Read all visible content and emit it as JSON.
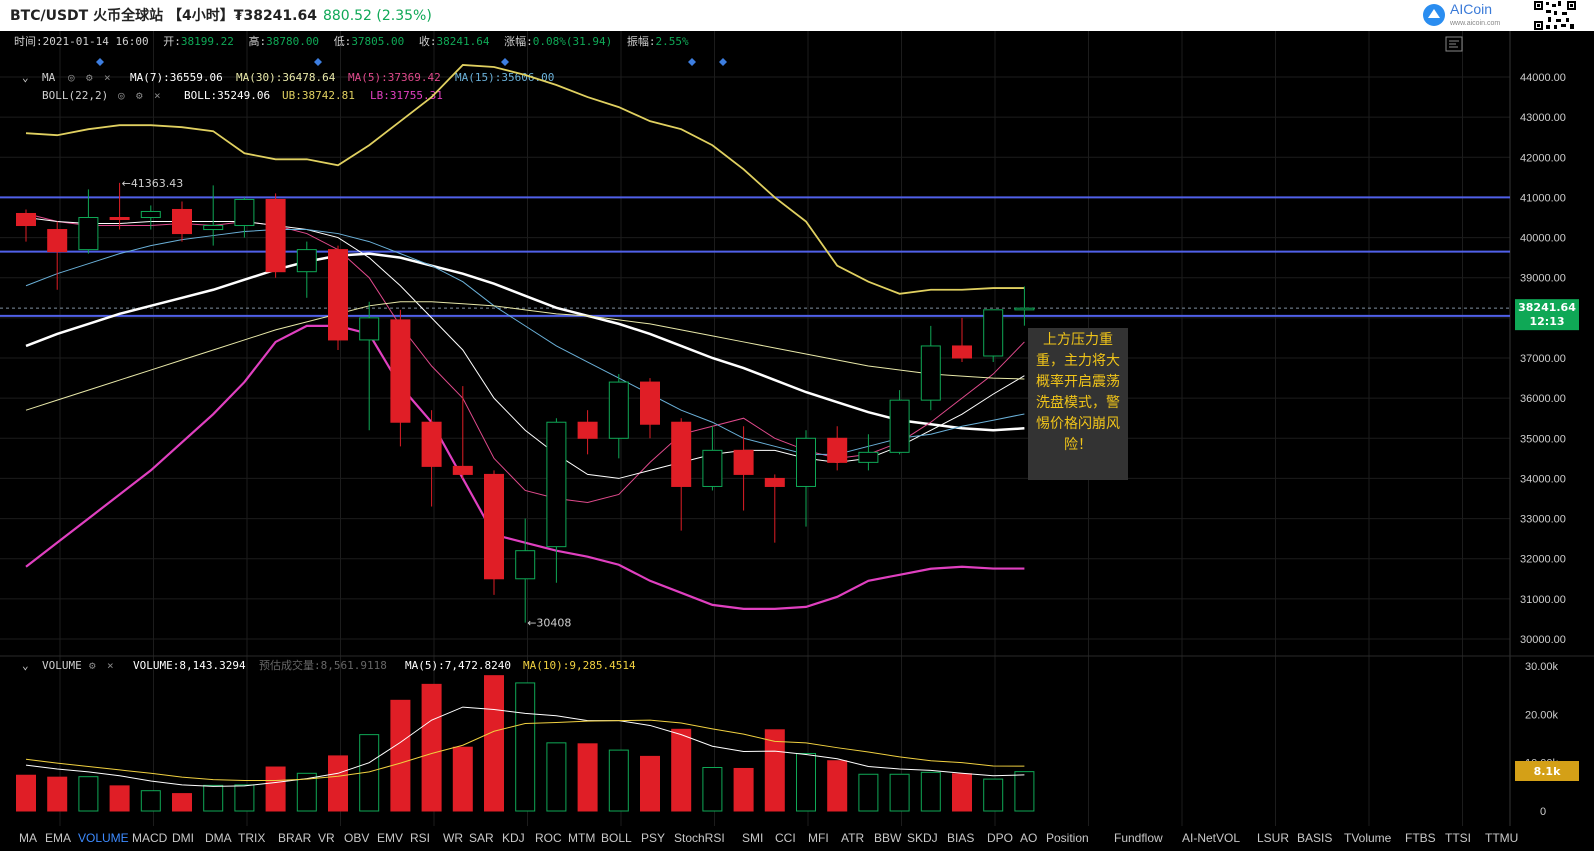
{
  "header": {
    "title": "BTC/USDT 火币全球站 【4小时】₮38241.64",
    "change": "880.52 (2.35%)",
    "logo_text": "AICoin",
    "logo_sub": "www.aicoin.com"
  },
  "info_bar": {
    "time_label": "时间:",
    "time": "2021-01-14 16:00",
    "open_label": "开:",
    "open": "38199.22",
    "high_label": "高:",
    "high": "38780.00",
    "low_label": "低:",
    "low": "37805.00",
    "close_label": "收:",
    "close": "38241.64",
    "chg_label": "涨幅:",
    "chg": "0.08%(31.94)",
    "amp_label": "振幅:",
    "amp": "2.55%"
  },
  "ma_legend": {
    "name": "MA",
    "ma7": "MA(7):36559.06",
    "ma30": "MA(30):36478.64",
    "ma5": "MA(5):37369.42",
    "ma15": "MA(15):35606.00"
  },
  "boll_legend": {
    "name": "BOLL(22,2)",
    "boll": "BOLL:35249.06",
    "ub": "UB:38742.81",
    "lb": "LB:31755.31"
  },
  "volume_legend": {
    "name": "VOLUME",
    "vol": "VOLUME:8,143.3294",
    "est": "预估成交量:8,561.9118",
    "ma5": "MA(5):7,472.8240",
    "ma10": "MA(10):9,285.4514"
  },
  "annotations": {
    "high_mark": "41363.43",
    "low_mark": "30408",
    "callout": "上方压力重重，主力将大概率开启震荡洗盘模式，警惕价格闪崩风险！"
  },
  "price_tag": {
    "price": "38241.64",
    "countdown": "12:13"
  },
  "volume_tag": "8.1k",
  "colors": {
    "up": "#0fa856",
    "down": "#e01e26",
    "ma7": "#ffffff",
    "ma30": "#e8e8a8",
    "ma5": "#e04a8c",
    "ma15": "#6ab0d8",
    "boll_mid": "#ffffff",
    "boll_ub": "#e0d060",
    "boll_lb": "#e040c0",
    "hline": "#5060e8"
  },
  "tabs": [
    "MA",
    "EMA",
    "VOLUME",
    "MACD",
    "DMI",
    "DMA",
    "TRIX",
    "BRAR",
    "VR",
    "OBV",
    "EMV",
    "RSI",
    "WR",
    "SAR",
    "KDJ",
    "ROC",
    "MTM",
    "BOLL",
    "PSY",
    "StochRSI",
    "SMI",
    "CCI",
    "MFI",
    "ATR",
    "BBW",
    "SKDJ",
    "BIAS",
    "DPO",
    "AO",
    "Position",
    "Fundflow",
    "AI-NetVOL",
    "LSUR",
    "BASIS",
    "TVolume",
    "FTBS",
    "TTSI",
    "TTMU"
  ],
  "active_tab": "VOLUME",
  "chart_data": {
    "type": "candlestick",
    "price_axis": {
      "min": 30000,
      "max": 44000,
      "ticks": [
        "44000.00",
        "43000.00",
        "42000.00",
        "41000.00",
        "40000.00",
        "39000.00",
        "38000.00",
        "37000.00",
        "36000.00",
        "35000.00",
        "34000.00",
        "33000.00",
        "32000.00",
        "31000.00",
        "30000.00"
      ]
    },
    "volume_axis": {
      "ticks": [
        "30.00k",
        "20.00k",
        "10.00k",
        "0"
      ]
    },
    "horizontal_lines": [
      41000,
      39650,
      38050
    ],
    "candles": [
      {
        "o": 40600,
        "h": 40700,
        "l": 39900,
        "c": 40300
      },
      {
        "o": 40200,
        "h": 40400,
        "l": 38700,
        "c": 39650
      },
      {
        "o": 39700,
        "h": 41200,
        "l": 39600,
        "c": 40500
      },
      {
        "o": 40500,
        "h": 41363,
        "l": 40200,
        "c": 40450
      },
      {
        "o": 40500,
        "h": 40800,
        "l": 40200,
        "c": 40650
      },
      {
        "o": 40700,
        "h": 40900,
        "l": 39900,
        "c": 40100
      },
      {
        "o": 40200,
        "h": 41300,
        "l": 39800,
        "c": 40300
      },
      {
        "o": 40300,
        "h": 41000,
        "l": 40000,
        "c": 40950
      },
      {
        "o": 40950,
        "h": 41100,
        "l": 39000,
        "c": 39150
      },
      {
        "o": 39150,
        "h": 39900,
        "l": 38500,
        "c": 39700
      },
      {
        "o": 39700,
        "h": 39800,
        "l": 37200,
        "c": 37450
      },
      {
        "o": 37450,
        "h": 38400,
        "l": 35200,
        "c": 38000
      },
      {
        "o": 37950,
        "h": 38200,
        "l": 34800,
        "c": 35400
      },
      {
        "o": 35400,
        "h": 35700,
        "l": 33300,
        "c": 34300
      },
      {
        "o": 34300,
        "h": 36300,
        "l": 34000,
        "c": 34100
      },
      {
        "o": 34100,
        "h": 34200,
        "l": 31100,
        "c": 31500
      },
      {
        "o": 31500,
        "h": 33000,
        "l": 30408,
        "c": 32200
      },
      {
        "o": 32300,
        "h": 35500,
        "l": 31400,
        "c": 35400
      },
      {
        "o": 35400,
        "h": 35700,
        "l": 34600,
        "c": 35000
      },
      {
        "o": 35000,
        "h": 36600,
        "l": 34500,
        "c": 36400
      },
      {
        "o": 36400,
        "h": 36500,
        "l": 35000,
        "c": 35350
      },
      {
        "o": 35400,
        "h": 35500,
        "l": 32700,
        "c": 33800
      },
      {
        "o": 33800,
        "h": 35300,
        "l": 33700,
        "c": 34700
      },
      {
        "o": 34700,
        "h": 35300,
        "l": 33200,
        "c": 34100
      },
      {
        "o": 34000,
        "h": 34100,
        "l": 32400,
        "c": 33800
      },
      {
        "o": 33800,
        "h": 35200,
        "l": 32800,
        "c": 35000
      },
      {
        "o": 35000,
        "h": 35300,
        "l": 34200,
        "c": 34400
      },
      {
        "o": 34400,
        "h": 35100,
        "l": 34200,
        "c": 34650
      },
      {
        "o": 34650,
        "h": 36200,
        "l": 34600,
        "c": 35950
      },
      {
        "o": 35950,
        "h": 37800,
        "l": 35700,
        "c": 37300
      },
      {
        "o": 37300,
        "h": 38000,
        "l": 36900,
        "c": 37000
      },
      {
        "o": 37050,
        "h": 38200,
        "l": 36900,
        "c": 38200
      },
      {
        "o": 38199,
        "h": 38780,
        "l": 37805,
        "c": 38241
      }
    ],
    "volumes": [
      7400,
      7000,
      7100,
      5200,
      4200,
      3600,
      5300,
      5400,
      9100,
      7800,
      11400,
      15800,
      22900,
      26200,
      13200,
      28000,
      26500,
      14100,
      13900,
      12600,
      11300,
      16900,
      9000,
      8800,
      16800,
      11900,
      10400,
      7600,
      7600,
      8000,
      7700,
      6600,
      8143
    ],
    "series": [
      {
        "name": "MA(5)",
        "values": [
          40600,
          40400,
          40300,
          40300,
          40300,
          40350,
          40300,
          40400,
          40300,
          40100,
          39700,
          39000,
          37800,
          36800,
          36000,
          34500,
          33700,
          33500,
          33400,
          33600,
          34400,
          35100,
          35300,
          35500,
          35000,
          34700,
          34500,
          34600,
          34900,
          35400,
          36000,
          36600,
          37400
        ]
      },
      {
        "name": "MA(7)",
        "values": [
          40500,
          40400,
          40350,
          40350,
          40400,
          40400,
          40400,
          40400,
          40300,
          40200,
          40000,
          39500,
          38800,
          38000,
          37200,
          36000,
          35200,
          34600,
          34100,
          34000,
          34200,
          34400,
          34600,
          34700,
          34700,
          34500,
          34400,
          34500,
          34800,
          35200,
          35600,
          36100,
          36559
        ]
      },
      {
        "name": "MA(15)",
        "values": [
          38800,
          39100,
          39350,
          39600,
          39800,
          39950,
          40050,
          40150,
          40200,
          40200,
          40100,
          39900,
          39600,
          39300,
          38900,
          38300,
          37800,
          37300,
          36900,
          36500,
          36100,
          35700,
          35400,
          35000,
          34800,
          34600,
          34600,
          34800,
          35000,
          35100,
          35300,
          35450,
          35606
        ]
      },
      {
        "name": "MA(30)",
        "values": [
          35700,
          35950,
          36200,
          36450,
          36700,
          36950,
          37200,
          37450,
          37700,
          37900,
          38100,
          38300,
          38400,
          38400,
          38350,
          38300,
          38200,
          38100,
          38050,
          37950,
          37850,
          37700,
          37550,
          37400,
          37250,
          37100,
          36950,
          36800,
          36700,
          36600,
          36550,
          36500,
          36478
        ]
      },
      {
        "name": "BOLL",
        "values": [
          37300,
          37600,
          37850,
          38100,
          38300,
          38500,
          38700,
          38950,
          39200,
          39400,
          39550,
          39600,
          39500,
          39300,
          39100,
          38850,
          38550,
          38250,
          38050,
          37850,
          37600,
          37300,
          37000,
          36750,
          36450,
          36150,
          35900,
          35650,
          35450,
          35350,
          35250,
          35200,
          35249
        ]
      },
      {
        "name": "UB",
        "values": [
          42600,
          42550,
          42700,
          42800,
          42800,
          42750,
          42650,
          42100,
          41950,
          41950,
          41800,
          42300,
          42900,
          43500,
          44300,
          44250,
          44050,
          43800,
          43500,
          43250,
          42900,
          42700,
          42300,
          41700,
          41000,
          40400,
          39300,
          38900,
          38600,
          38700,
          38700,
          38742,
          38742
        ]
      },
      {
        "name": "LB",
        "values": [
          31800,
          32400,
          33000,
          33600,
          34200,
          34900,
          35600,
          36400,
          37400,
          37800,
          37800,
          37600,
          36300,
          35400,
          34000,
          32600,
          32400,
          32200,
          32050,
          31850,
          31450,
          31150,
          30850,
          30750,
          30750,
          30800,
          31050,
          31450,
          31600,
          31750,
          31800,
          31755,
          31755
        ]
      },
      {
        "name": "VOL MA(5)",
        "values": [
          9500,
          8700,
          8100,
          7300,
          6200,
          5400,
          5100,
          5200,
          5900,
          6700,
          7800,
          10000,
          14200,
          18800,
          21500,
          21000,
          20200,
          19700,
          18700,
          18700,
          17700,
          15800,
          13400,
          12300,
          12400,
          11700,
          10800,
          9200,
          8700,
          8400,
          7800,
          7300,
          7473
        ]
      },
      {
        "name": "VOL MA(10)",
        "values": [
          10700,
          9900,
          9200,
          8500,
          7800,
          7000,
          6500,
          6300,
          6300,
          6600,
          7200,
          8100,
          9900,
          11900,
          13600,
          16500,
          18100,
          18300,
          18600,
          18700,
          18800,
          18200,
          17000,
          15900,
          14400,
          14100,
          13100,
          12200,
          11200,
          10400,
          10000,
          9300,
          9285
        ]
      }
    ]
  }
}
